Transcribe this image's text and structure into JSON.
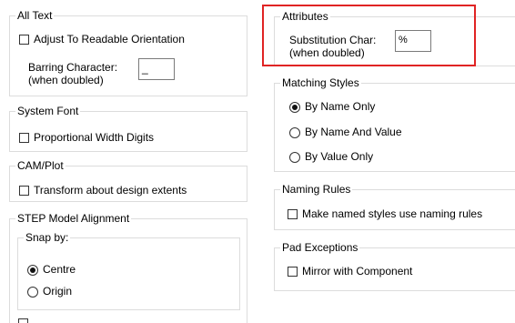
{
  "left": {
    "all_text": {
      "title": "All Text",
      "adjust_label": "Adjust To Readable Orientation",
      "barring_label_1": "Barring Character:",
      "barring_label_2": "(when doubled)",
      "barring_value": "_"
    },
    "system_font": {
      "title": "System Font",
      "proportional_label": "Proportional Width Digits"
    },
    "cam_plot": {
      "title": "CAM/Plot",
      "transform_label": "Transform about design extents"
    },
    "step": {
      "title": "STEP Model Alignment",
      "snap_title": "Snap by:",
      "options": [
        {
          "label": "Centre",
          "selected": true
        },
        {
          "label": "Origin",
          "selected": false
        }
      ]
    }
  },
  "right": {
    "attributes": {
      "title": "Attributes",
      "subst_label_1": "Substitution Char:",
      "subst_label_2": "(when doubled)",
      "subst_value": "%"
    },
    "matching_styles": {
      "title": "Matching Styles",
      "options": [
        {
          "label": "By Name Only",
          "selected": true
        },
        {
          "label": "By Name And Value",
          "selected": false
        },
        {
          "label": "By Value Only",
          "selected": false
        }
      ]
    },
    "naming_rules": {
      "title": "Naming Rules",
      "make_named_label": "Make named styles use naming rules"
    },
    "pad_exceptions": {
      "title": "Pad Exceptions",
      "mirror_label": "Mirror with Component"
    }
  },
  "colors": {
    "highlight": "#e02424",
    "group_border": "#dcdcdc"
  }
}
